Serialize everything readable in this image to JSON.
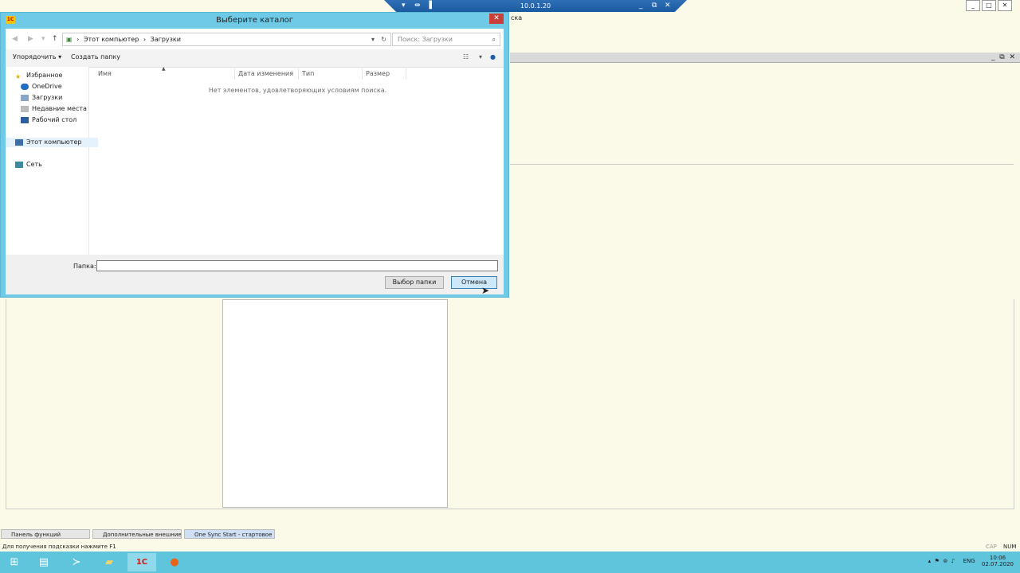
{
  "rdp": {
    "ip": "10.0.1.20",
    "minimize": "_",
    "restore": "⧉",
    "close": "✕"
  },
  "app": {
    "partial_text": "ска"
  },
  "dialog": {
    "title": "Выберите каталог",
    "address": {
      "root": "Этот компьютер",
      "folder": "Загрузки"
    },
    "search_placeholder": "Поиск: Загрузки",
    "toolbar": {
      "organize": "Упорядочить",
      "new_folder": "Создать папку"
    },
    "nav": {
      "favorites": "Избранное",
      "onedrive": "OneDrive",
      "downloads": "Загрузки",
      "recent": "Недавние места",
      "desktop": "Рабочий стол",
      "this_pc": "Этот компьютер",
      "network": "Сеть"
    },
    "columns": {
      "name": "Имя",
      "date": "Дата изменения",
      "type": "Тип",
      "size": "Размер"
    },
    "empty_text": "Нет элементов, удовлетворяющих условиям поиска.",
    "folder_label": "Папка:",
    "folder_value": "",
    "select_button": "Выбор папки",
    "cancel_button": "Отмена"
  },
  "tabs": [
    "Панель функций",
    "Дополнительные внешние о...",
    "One Sync Start - стартовое о..."
  ],
  "status": {
    "hint": "Для получения подсказки нажмите F1",
    "cap": "CAP",
    "num": "NUM"
  },
  "tray": {
    "lang": "ENG",
    "time": "10:06",
    "date": "02.07.2020"
  },
  "colors": {
    "taskbar": "#5fc5dd",
    "dialog_frame": "#6ecae6"
  }
}
